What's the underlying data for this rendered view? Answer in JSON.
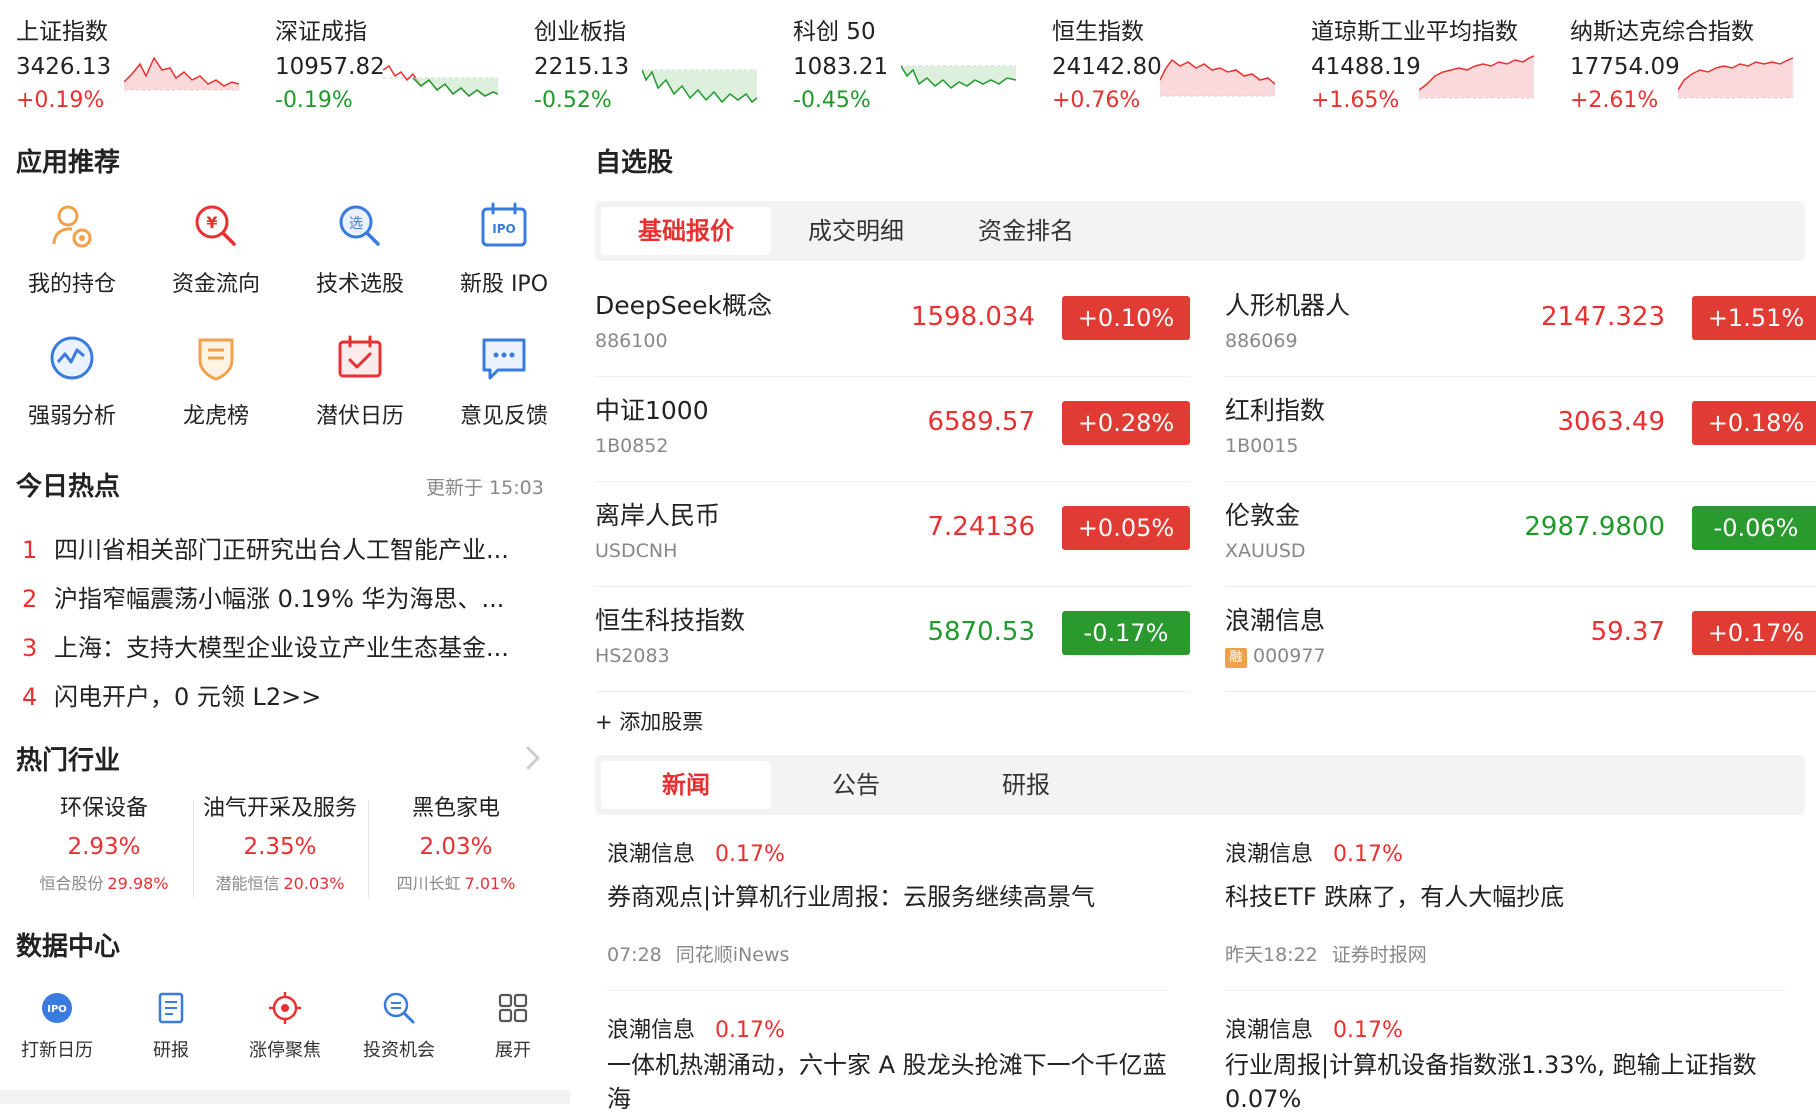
{
  "indices": [
    {
      "name": "上证指数",
      "price": "3426.13",
      "pct": "+0.19%",
      "trend": "up"
    },
    {
      "name": "深证成指",
      "price": "10957.82",
      "pct": "-0.19%",
      "trend": "down"
    },
    {
      "name": "创业板指",
      "price": "2215.13",
      "pct": "-0.52%",
      "trend": "down"
    },
    {
      "name": "科创 50",
      "price": "1083.21",
      "pct": "-0.45%",
      "trend": "down"
    },
    {
      "name": "恒生指数",
      "price": "24142.80",
      "pct": "+0.76%",
      "trend": "up"
    },
    {
      "name": "道琼斯工业平均指数",
      "price": "41488.19",
      "pct": "+1.65%",
      "trend": "up"
    },
    {
      "name": "纳斯达克综合指数",
      "price": "17754.09",
      "pct": "+2.61%",
      "trend": "up"
    }
  ],
  "apps": {
    "title": "应用推荐",
    "items": [
      {
        "label": "我的持仓",
        "icon": "holdings-icon"
      },
      {
        "label": "资金流向",
        "icon": "capital-flow-icon"
      },
      {
        "label": "技术选股",
        "icon": "stock-picker-icon"
      },
      {
        "label": "新股 IPO",
        "icon": "ipo-icon"
      },
      {
        "label": "强弱分析",
        "icon": "strength-analysis-icon"
      },
      {
        "label": "龙虎榜",
        "icon": "dragon-tiger-icon"
      },
      {
        "label": "潜伏日历",
        "icon": "calendar-icon"
      },
      {
        "label": "意见反馈",
        "icon": "feedback-icon"
      }
    ]
  },
  "hot_today": {
    "title": "今日热点",
    "updated": "更新于 15:03",
    "items": [
      {
        "rank": "1",
        "title": "四川省相关部门正研究出台人工智能产业..."
      },
      {
        "rank": "2",
        "title": "沪指窄幅震荡小幅涨 0.19% 华为海思、..."
      },
      {
        "rank": "3",
        "title": "上海：支持大模型企业设立产业生态基金..."
      },
      {
        "rank": "4",
        "title": "闪电开户，0 元领 L2>>"
      }
    ]
  },
  "industries": {
    "title": "热门行业",
    "items": [
      {
        "name": "环保设备",
        "pct": "2.93%",
        "leader": "恒合股份",
        "leader_pct": "29.98%"
      },
      {
        "name": "油气开采及服务",
        "pct": "2.35%",
        "leader": "潜能恒信",
        "leader_pct": "20.03%"
      },
      {
        "name": "黑色家电",
        "pct": "2.03%",
        "leader": "四川长虹",
        "leader_pct": "7.01%"
      }
    ]
  },
  "data_center": {
    "title": "数据中心",
    "items": [
      {
        "label": "打新日历",
        "icon": "ipo-calendar-icon"
      },
      {
        "label": "研报",
        "icon": "research-report-icon"
      },
      {
        "label": "涨停聚焦",
        "icon": "limit-up-focus-icon"
      },
      {
        "label": "投资机会",
        "icon": "investment-opportunity-icon"
      },
      {
        "label": "展开",
        "icon": "grid-expand-icon"
      }
    ]
  },
  "watchlist": {
    "title": "自选股",
    "tabs": [
      "基础报价",
      "成交明细",
      "资金排名"
    ],
    "active_tab": 0,
    "items": [
      {
        "name": "DeepSeek概念",
        "code": "886100",
        "price": "1598.034",
        "chg": "+0.10%",
        "trend": "up",
        "badge": ""
      },
      {
        "name": "人形机器人",
        "code": "886069",
        "price": "2147.323",
        "chg": "+1.51%",
        "trend": "up",
        "badge": ""
      },
      {
        "name": "中证1000",
        "code": "1B0852",
        "price": "6589.57",
        "chg": "+0.28%",
        "trend": "up",
        "badge": ""
      },
      {
        "name": "红利指数",
        "code": "1B0015",
        "price": "3063.49",
        "chg": "+0.18%",
        "trend": "up",
        "badge": ""
      },
      {
        "name": "离岸人民币",
        "code": "USDCNH",
        "price": "7.24136",
        "chg": "+0.05%",
        "trend": "up",
        "badge": ""
      },
      {
        "name": "伦敦金",
        "code": "XAUUSD",
        "price": "2987.9800",
        "chg": "-0.06%",
        "trend": "down",
        "badge": ""
      },
      {
        "name": "恒生科技指数",
        "code": "HS2083",
        "price": "5870.53",
        "chg": "-0.17%",
        "trend": "down",
        "badge": ""
      },
      {
        "name": "浪潮信息",
        "code": "000977",
        "price": "59.37",
        "chg": "+0.17%",
        "trend": "up",
        "badge": "融"
      }
    ],
    "add_label": "+ 添加股票"
  },
  "news": {
    "tabs": [
      "新闻",
      "公告",
      "研报"
    ],
    "active_tab": 0,
    "items": [
      {
        "stock": "浪潮信息",
        "pct": "0.17%",
        "title": "券商观点|计算机行业周报：云服务继续高景气",
        "time": "07:28",
        "source": "同花顺iNews"
      },
      {
        "stock": "浪潮信息",
        "pct": "0.17%",
        "title": "科技ETF 跌麻了，有人大幅抄底",
        "time": "昨天18:22",
        "source": "证券时报网"
      },
      {
        "stock": "浪潮信息",
        "pct": "0.17%",
        "title": "一体机热潮涌动，六十家 A 股龙头抢滩下一个千亿蓝海",
        "time": "",
        "source": ""
      },
      {
        "stock": "浪潮信息",
        "pct": "0.17%",
        "title": "行业周报|计算机设备指数涨1.33%, 跑输上证指数0.07%",
        "time": "",
        "source": ""
      }
    ]
  },
  "colors": {
    "up": "#e93030",
    "down": "#1f9a2b",
    "up_bg": "#e03c33",
    "down_bg": "#2a9a2e"
  }
}
